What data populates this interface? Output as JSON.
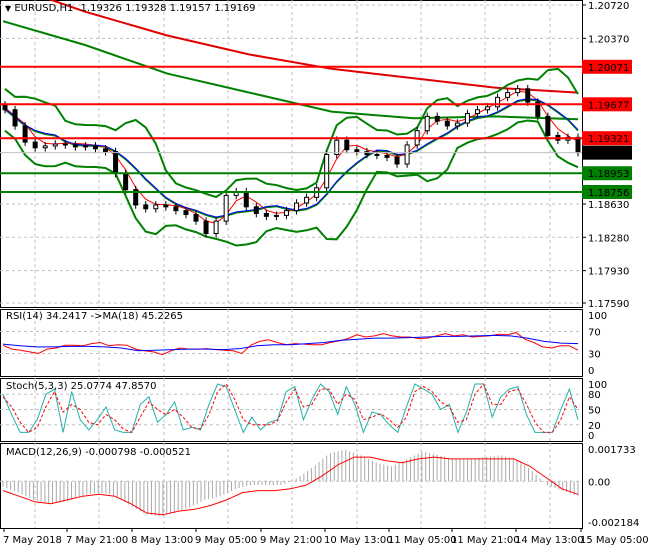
{
  "header": {
    "symbol": "EURUSD,H1",
    "open": "1.19326",
    "high": "1.19328",
    "low": "1.19157",
    "close": "1.19169"
  },
  "chart_data": [
    {
      "type": "candlestick",
      "title": "EURUSD,H1",
      "ylim": [
        1.1759,
        1.2072
      ],
      "y_ticks": [
        "1.20720",
        "1.20370",
        "1.18630",
        "1.18280",
        "1.17930",
        "1.17590"
      ],
      "y_tick_values": [
        1.2072,
        1.2037,
        1.1863,
        1.1828,
        1.1793,
        1.1759
      ],
      "closes": [
        1.1962,
        1.1945,
        1.1928,
        1.1922,
        1.1924,
        1.1926,
        1.1925,
        1.1923,
        1.1924,
        1.1921,
        1.1918,
        1.1895,
        1.1878,
        1.1862,
        1.1858,
        1.1862,
        1.186,
        1.1856,
        1.1852,
        1.1845,
        1.1832,
        1.1845,
        1.1872,
        1.1876,
        1.186,
        1.1853,
        1.185,
        1.1851,
        1.1856,
        1.1864,
        1.187,
        1.188,
        1.1915,
        1.193,
        1.192,
        1.1918,
        1.1915,
        1.1914,
        1.1912,
        1.1905,
        1.1925,
        1.194,
        1.1955,
        1.195,
        1.1945,
        1.1948,
        1.1958,
        1.1962,
        1.1965,
        1.1975,
        1.198,
        1.1984,
        1.197,
        1.1955,
        1.1935,
        1.193,
        1.1933,
        1.1917
      ],
      "ma_slow_red": [
        1.2095,
        1.2065,
        1.204,
        1.202,
        1.2005,
        1.1995,
        1.1985,
        1.198
      ],
      "ma_slow_green": [
        1.2055,
        1.203,
        1.2,
        1.198,
        1.196,
        1.1953,
        1.1955,
        1.1952
      ],
      "levels": [
        {
          "value": "1.20071",
          "price": 1.20071,
          "color": "#ff0000"
        },
        {
          "value": "1.19677",
          "price": 1.19677,
          "color": "#ff0000"
        },
        {
          "value": "1.19321",
          "price": 1.19321,
          "color": "#ff0000"
        },
        {
          "value": "1.18953",
          "price": 1.18953,
          "color": "#008000"
        },
        {
          "value": "1.18756",
          "price": 1.18756,
          "color": "#008000"
        }
      ],
      "current_price": {
        "value": "1.19169",
        "price": 1.19169
      }
    },
    {
      "type": "line",
      "title": "RSI(14) 34.2417  ->MA(18) 45.2265",
      "ylim": [
        0,
        100
      ],
      "y_ticks": [
        "100",
        "70",
        "30",
        "0"
      ],
      "y_tick_values": [
        100,
        70,
        30,
        0
      ],
      "series": [
        {
          "name": "RSI(14)",
          "color": "#ff0000",
          "values": [
            45,
            38,
            36,
            33,
            30,
            38,
            40,
            45,
            45,
            44,
            48,
            50,
            44,
            46,
            45,
            38,
            35,
            33,
            28,
            35,
            40,
            38,
            38,
            39,
            37,
            36,
            35,
            30,
            45,
            52,
            55,
            50,
            46,
            48,
            47,
            46,
            46,
            50,
            53,
            57,
            64,
            60,
            62,
            66,
            62,
            60,
            60,
            57,
            58,
            62,
            66,
            62,
            64,
            60,
            61,
            62,
            65,
            64,
            68,
            56,
            50,
            42,
            40,
            44,
            44,
            36
          ]
        },
        {
          "name": "MA(18)",
          "color": "#0000ff",
          "values": [
            47,
            44,
            42,
            42,
            43,
            43,
            42,
            40,
            35,
            36,
            37,
            38,
            38,
            37,
            39,
            44,
            46,
            46,
            48,
            50,
            54,
            56,
            58,
            58,
            59,
            60,
            61,
            61,
            62,
            63,
            62,
            58,
            52,
            49,
            48
          ]
        }
      ]
    },
    {
      "type": "line",
      "title": "Stoch(5,3,3) 25.0774 47.8570",
      "ylim": [
        0,
        100
      ],
      "y_ticks": [
        "100",
        "80",
        "50",
        "20",
        "0"
      ],
      "y_tick_values": [
        100,
        80,
        50,
        20,
        0
      ],
      "series": [
        {
          "name": "Main",
          "color": "#20b2aa",
          "values": [
            80,
            40,
            5,
            5,
            30,
            80,
            90,
            5,
            85,
            30,
            10,
            30,
            55,
            10,
            5,
            5,
            60,
            75,
            25,
            40,
            65,
            10,
            15,
            10,
            60,
            100,
            95,
            50,
            5,
            35,
            10,
            25,
            30,
            85,
            95,
            30,
            70,
            100,
            85,
            40,
            95,
            60,
            5,
            45,
            40,
            20,
            5,
            55,
            100,
            90,
            80,
            50,
            60,
            5,
            45,
            100,
            100,
            35,
            75,
            90,
            95,
            40,
            5,
            5,
            5,
            50,
            90,
            30
          ]
        },
        {
          "name": "Signal",
          "color": "#ff0000",
          "values": [
            75,
            55,
            25,
            5,
            15,
            55,
            85,
            45,
            60,
            50,
            25,
            20,
            40,
            30,
            12,
            5,
            35,
            65,
            50,
            40,
            50,
            35,
            15,
            12,
            40,
            85,
            100,
            70,
            30,
            20,
            20,
            20,
            28,
            65,
            90,
            55,
            60,
            90,
            90,
            60,
            80,
            70,
            30,
            35,
            42,
            30,
            15,
            35,
            85,
            95,
            85,
            65,
            55,
            25,
            30,
            80,
            100,
            60,
            60,
            85,
            90,
            60,
            25,
            5,
            5,
            30,
            75,
            50
          ]
        }
      ]
    },
    {
      "type": "bar",
      "title": "MACD(12,26,9) -0.000798 -0.000521",
      "ylim": [
        -0.002184,
        0.001733
      ],
      "y_ticks": [
        "0.001733",
        "0.00",
        "-0.002184"
      ],
      "y_tick_values": [
        0.001733,
        0,
        -0.002184
      ],
      "series": [
        {
          "name": "MACD",
          "color": "#a9a9a9",
          "values": [
            -0.0003,
            -0.0006,
            -0.001,
            -0.0012,
            -0.0011,
            -0.0008,
            -0.0006,
            -0.0007,
            -0.0012,
            -0.0017,
            -0.0019,
            -0.0017,
            -0.0014,
            -0.001,
            -0.0008,
            -0.0004,
            -0.0002,
            -0.0002,
            -0.0002,
            0.0002,
            0.0008,
            0.0015,
            0.0017,
            0.0014,
            0.001,
            0.0008,
            0.0012,
            0.0016,
            0.0014,
            0.0012,
            0.0012,
            0.0013,
            0.0014,
            0.0012,
            0.0006,
            -0.0002,
            -0.0005,
            -0.0008
          ]
        },
        {
          "name": "Signal",
          "color": "#ff0000",
          "values": [
            -0.0005,
            -0.0008,
            -0.0011,
            -0.0012,
            -0.001,
            -0.0008,
            -0.0007,
            -0.0008,
            -0.0012,
            -0.0017,
            -0.0018,
            -0.0016,
            -0.0015,
            -0.0013,
            -0.001,
            -0.0006,
            -0.0005,
            -0.0005,
            -0.0004,
            -0.0002,
            0.0003,
            0.0009,
            0.0013,
            0.0013,
            0.0011,
            0.001,
            0.0012,
            0.0013,
            0.0012,
            0.0012,
            0.0012,
            0.0012,
            0.0012,
            0.0008,
            0.0002,
            -0.0004,
            -0.0007
          ]
        }
      ]
    }
  ],
  "x_axis": {
    "labels": [
      "7 May 2018",
      "7 May 21:00",
      "8 May 13:00",
      "9 May 05:00",
      "9 May 21:00",
      "10 May 13:00",
      "11 May 05:00",
      "11 May 21:00",
      "14 May 13:00",
      "15 May 05:00"
    ]
  }
}
